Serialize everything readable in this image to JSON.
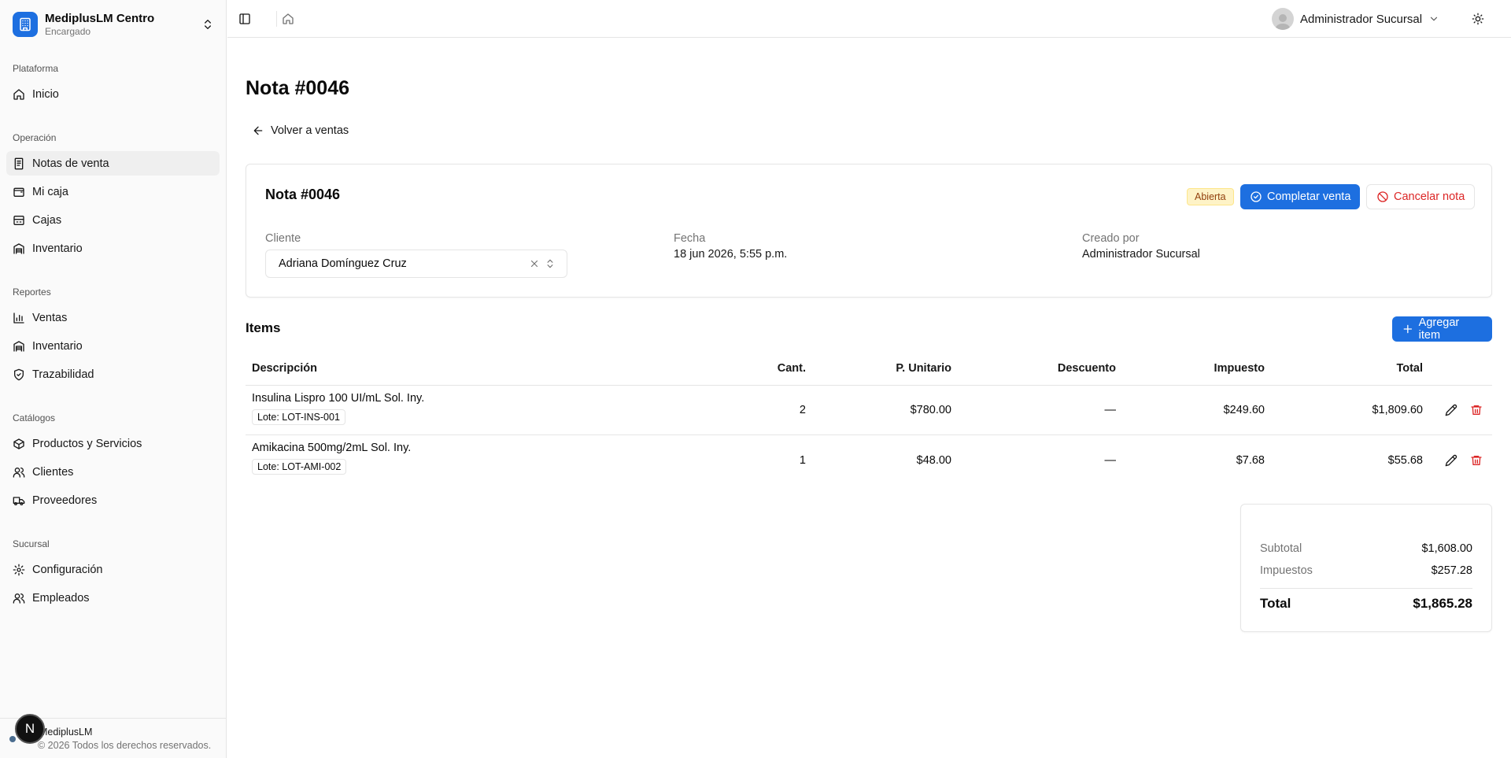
{
  "brand": {
    "name": "MediplusLM Centro",
    "role": "Encargado"
  },
  "sidebar": {
    "groups": [
      {
        "label": "Plataforma",
        "items": [
          {
            "label": "Inicio",
            "icon": "home-icon"
          }
        ]
      },
      {
        "label": "Operación",
        "items": [
          {
            "label": "Notas de venta",
            "icon": "receipt-icon",
            "active": true
          },
          {
            "label": "Mi caja",
            "icon": "wallet-icon"
          },
          {
            "label": "Cajas",
            "icon": "cash-register-icon"
          },
          {
            "label": "Inventario",
            "icon": "warehouse-icon"
          }
        ]
      },
      {
        "label": "Reportes",
        "items": [
          {
            "label": "Ventas",
            "icon": "bar-chart-icon"
          },
          {
            "label": "Inventario",
            "icon": "warehouse-icon"
          },
          {
            "label": "Trazabilidad",
            "icon": "shield-check-icon"
          }
        ]
      },
      {
        "label": "Catálogos",
        "items": [
          {
            "label": "Productos y Servicios",
            "icon": "package-icon"
          },
          {
            "label": "Clientes",
            "icon": "users-icon"
          },
          {
            "label": "Proveedores",
            "icon": "truck-icon"
          }
        ]
      },
      {
        "label": "Sucursal",
        "items": [
          {
            "label": "Configuración",
            "icon": "gear-icon"
          },
          {
            "label": "Empleados",
            "icon": "users-icon"
          }
        ]
      }
    ],
    "footer": {
      "name": "MediplusLM",
      "copyright": "© 2026 Todos los derechos reservados.",
      "badge": "N"
    }
  },
  "topbar": {
    "user_name": "Administrador Sucursal"
  },
  "page": {
    "title": "Nota #0046",
    "back_label": "Volver a ventas"
  },
  "note_card": {
    "title": "Nota #0046",
    "status": "Abierta",
    "complete_label": "Completar venta",
    "cancel_label": "Cancelar nota",
    "client_label": "Cliente",
    "client_value": "Adriana Domínguez Cruz",
    "date_label": "Fecha",
    "date_value": "18 jun 2026, 5:55 p.m.",
    "created_label": "Creado por",
    "created_value": "Administrador Sucursal"
  },
  "items": {
    "title": "Items",
    "add_label": "Agregar item",
    "headers": {
      "desc": "Descripción",
      "qty": "Cant.",
      "unit": "P. Unitario",
      "disc": "Descuento",
      "tax": "Impuesto",
      "total": "Total"
    },
    "rows": [
      {
        "desc": "Insulina Lispro 100 UI/mL Sol. Iny.",
        "lot": "Lote: LOT-INS-001",
        "qty": "2",
        "unit": "$780.00",
        "disc": "—",
        "tax": "$249.60",
        "total": "$1,809.60"
      },
      {
        "desc": "Amikacina 500mg/2mL Sol. Iny.",
        "lot": "Lote: LOT-AMI-002",
        "qty": "1",
        "unit": "$48.00",
        "disc": "—",
        "tax": "$7.68",
        "total": "$55.68"
      }
    ]
  },
  "summary": {
    "subtotal_label": "Subtotal",
    "subtotal_value": "$1,608.00",
    "taxes_label": "Impuestos",
    "taxes_value": "$257.28",
    "total_label": "Total",
    "total_value": "$1,865.28"
  },
  "colors": {
    "primary": "#1d6fe0",
    "danger": "#dc2626",
    "badge_bg": "#fef3c7",
    "badge_text": "#92400e"
  }
}
